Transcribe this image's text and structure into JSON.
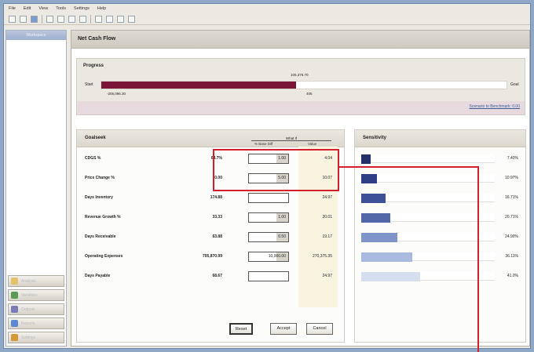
{
  "menu": [
    "File",
    "Edit",
    "View",
    "Tools",
    "Settings",
    "Help"
  ],
  "sidebar": {
    "header": "Workspace",
    "buttons": [
      {
        "label": "Analysis",
        "color": "#e3c36a"
      },
      {
        "label": "Variables",
        "color": "#5a9b52"
      },
      {
        "label": "Outputs",
        "color": "#7d7ab8"
      },
      {
        "label": "Reports",
        "color": "#5b8ad0"
      },
      {
        "label": "Settings",
        "color": "#d49a3a"
      }
    ]
  },
  "main": {
    "title": "Net Cash Flow"
  },
  "progress": {
    "title": "Progress",
    "start_label": "Start",
    "end_label": "Goal",
    "current_value": "105,375.70",
    "min_value": "-205,096.30",
    "max_value": "405",
    "fraction": 0.48,
    "link": "Scenario to Benchmark: 0.00"
  },
  "goalseek": {
    "title": "Goalseek",
    "group_label": "What If",
    "col_new": "% Base Diff",
    "col_value": "Value",
    "rows": [
      {
        "label": "CDGS %",
        "current": "64.7%",
        "input": "1.00",
        "value": "4.04"
      },
      {
        "label": "Price Change %",
        "current": "0.00",
        "input": "5.00",
        "value": "10.07"
      },
      {
        "label": "Days Inventory",
        "current": "174.88",
        "input": "",
        "value": "24.97"
      },
      {
        "label": "Revenue Growth %",
        "current": "33.33",
        "input": "1.00",
        "value": "20.01"
      },
      {
        "label": "Days Receivable",
        "current": "63.88",
        "input": "0.50",
        "value": "19.17"
      },
      {
        "label": "Operating Expenses",
        "current": "705,870.99",
        "input": "10,000.00",
        "value": "270,375.35"
      },
      {
        "label": "Days Payable",
        "current": "68.67",
        "input": "",
        "value": "24.97"
      }
    ],
    "buttons": {
      "reset": "Reset",
      "accept": "Accept",
      "cancel": "Cancel"
    }
  },
  "sensitivity": {
    "title": "Sensitivity",
    "bars": [
      {
        "fraction": 0.07,
        "pct": "7.40%",
        "color": "#23306a"
      },
      {
        "fraction": 0.12,
        "pct": "10.97%",
        "color": "#2f3f86"
      },
      {
        "fraction": 0.18,
        "pct": "16.71%",
        "color": "#3d5098"
      },
      {
        "fraction": 0.22,
        "pct": "20.71%",
        "color": "#5167a8"
      },
      {
        "fraction": 0.27,
        "pct": "24.90%",
        "color": "#7f95c9"
      },
      {
        "fraction": 0.38,
        "pct": "36.11%",
        "color": "#a9badf"
      },
      {
        "fraction": 0.44,
        "pct": "41.0%",
        "color": "#d6def0"
      }
    ]
  }
}
